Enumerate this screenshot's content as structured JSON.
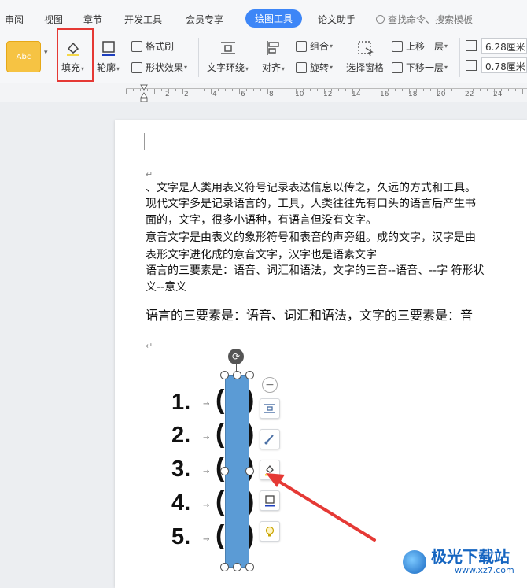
{
  "tabs": [
    "审阅",
    "视图",
    "章节",
    "开发工具",
    "会员专享",
    "绘图工具",
    "论文助手"
  ],
  "active_tab": "绘图工具",
  "search": {
    "label": "查找命令、搜索模板"
  },
  "ribbon": {
    "style_sample": "Abc",
    "fill": "填充",
    "outline": "轮廓",
    "format_brush": "格式刷",
    "shape_effect": "形状效果",
    "text_wrap": "文字环绕",
    "align": "对齐",
    "group": "组合",
    "rotate": "旋转",
    "selection_pane": "选择窗格",
    "bring_forward": "上移一层",
    "send_backward": "下移一层",
    "width": "6.28厘米",
    "height": "0.78厘米"
  },
  "ruler": {
    "numbers": [
      "2",
      "2",
      "4",
      "6",
      "8",
      "10",
      "12",
      "14",
      "16",
      "18",
      "20",
      "22",
      "24"
    ]
  },
  "document": {
    "lines": [
      "、文字是人类用表义符号记录表达信息以传之，久远的方式和工具。",
      "现代文字多是记录语言的，工具，人类往往先有口头的语言后产生书",
      "面的，文字，很多小语种，有语言但没有文字。",
      "意音文字是由表义的象形符号和表音的声旁组。成的文字，汉字是由",
      "表形文字进化成的意音文字，汉字也是语素文字",
      "语言的三要素是：语音、词汇和语法，文字的三音--语音、--字 符形状",
      "义--意义"
    ],
    "serif_line": "语言的三要素是：语音、词汇和语法，文字的三要素是：音"
  },
  "list_numbers": [
    "1.",
    "2.",
    "3.",
    "4.",
    "5."
  ],
  "colors": {
    "accent": "#3d86f7",
    "shape_fill": "#5b9bd5",
    "highlight": "#e53935",
    "arrow": "#e53935"
  },
  "watermark": {
    "name": "极光下载站",
    "url": "www.xz7.com"
  }
}
